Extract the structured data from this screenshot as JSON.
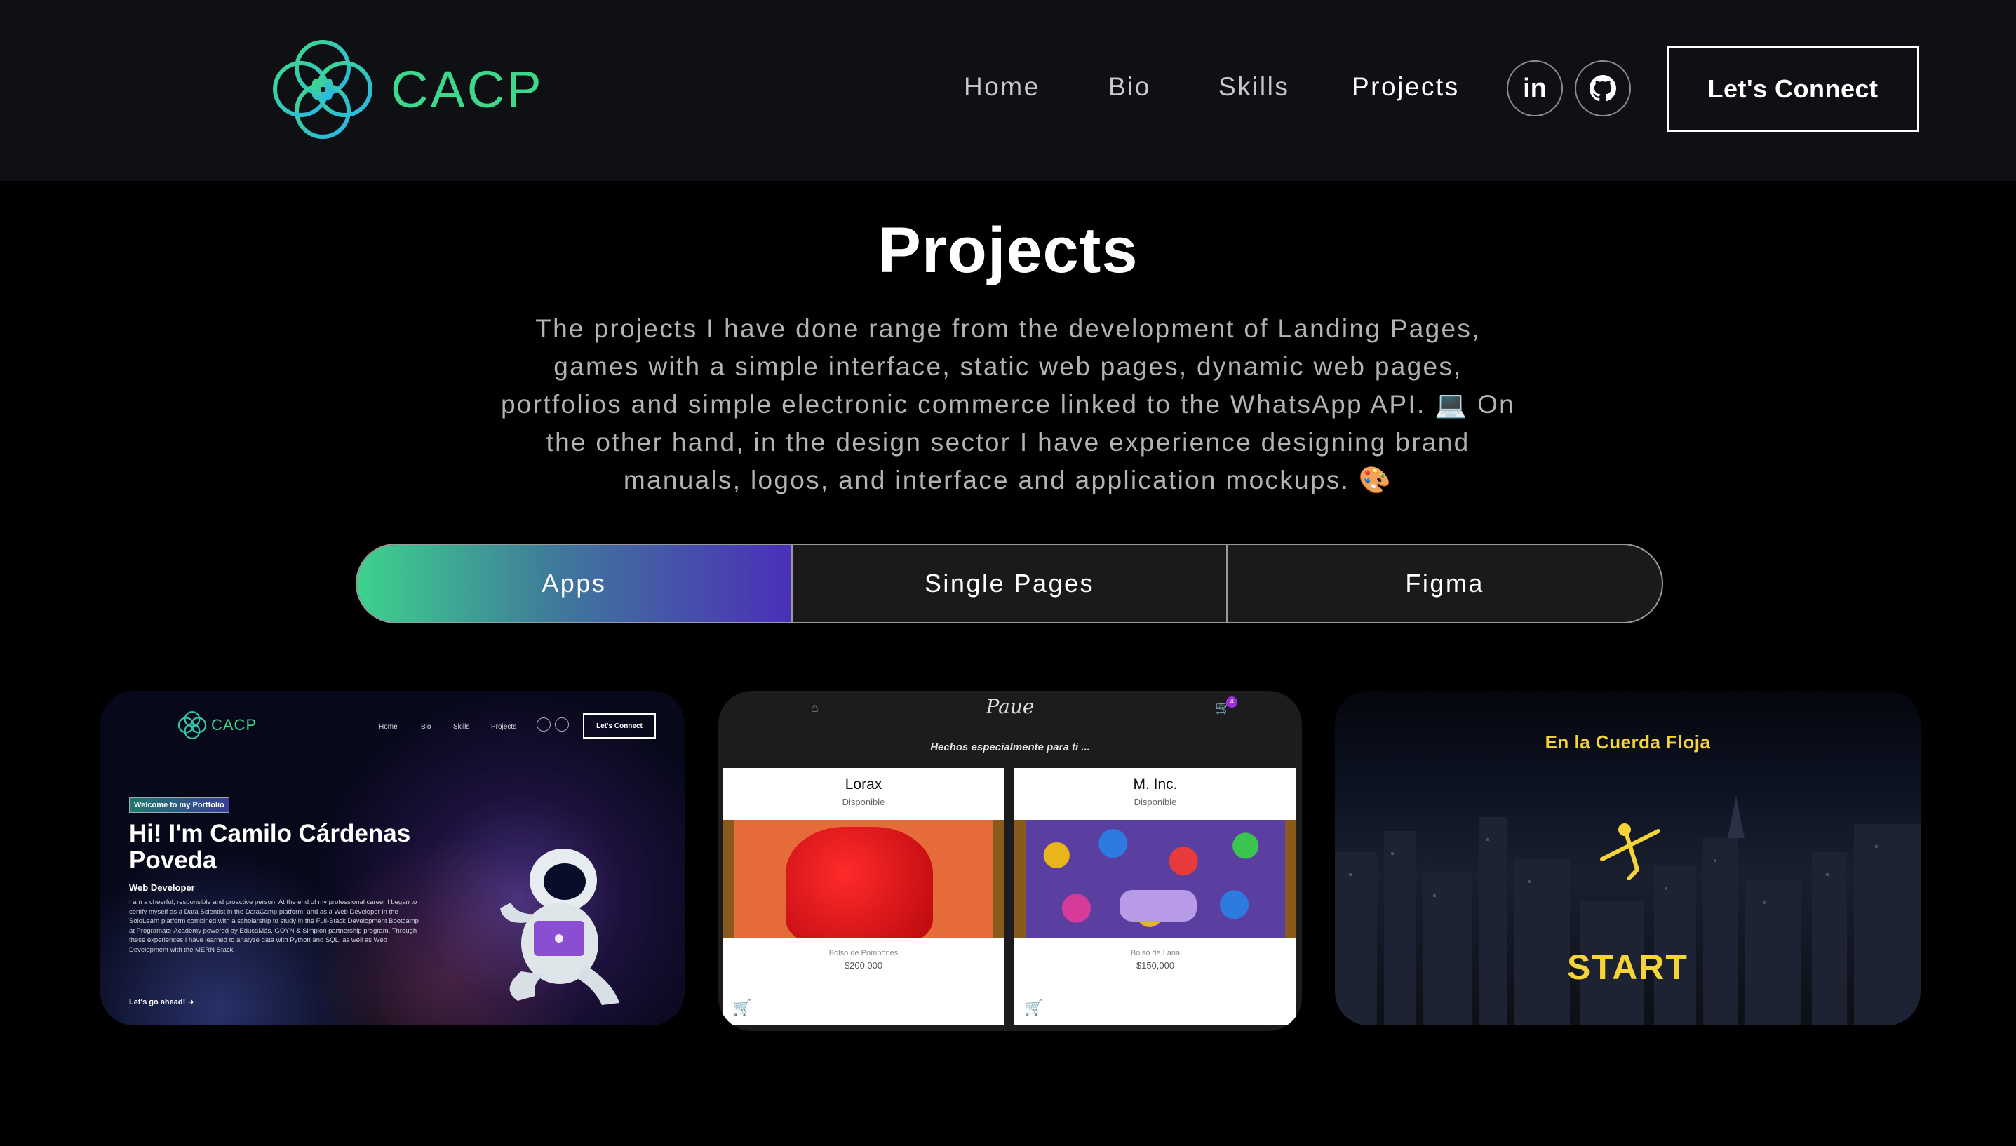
{
  "nav": {
    "logo_text": "CACP",
    "links": [
      {
        "label": "Home",
        "active": false
      },
      {
        "label": "Bio",
        "active": false
      },
      {
        "label": "Skills",
        "active": false
      },
      {
        "label": "Projects",
        "active": true
      }
    ],
    "social": [
      {
        "icon": "linkedin-icon",
        "label": "in"
      },
      {
        "icon": "github-icon"
      }
    ],
    "cta_label": "Let's Connect"
  },
  "section": {
    "title": "Projects",
    "description": "The projects I have done range from the development of Landing Pages, games with a simple interface, static web pages, dynamic web pages, portfolios and simple electronic commerce linked to the WhatsApp API. 💻 On the other hand, in the design sector I have experience designing brand manuals, logos, and interface and application mockups. 🎨"
  },
  "tabs": [
    {
      "label": "Apps",
      "active": true
    },
    {
      "label": "Single Pages",
      "active": false
    },
    {
      "label": "Figma",
      "active": false
    }
  ],
  "colors": {
    "accent_green": "#3ed88d",
    "accent_purple": "#4b2fb8",
    "nav_bg": "#0f1013",
    "game_yellow": "#f5d33a"
  },
  "cards": [
    {
      "kind": "portfolio",
      "logo_text": "CACP",
      "nav": [
        "Home",
        "Bio",
        "Skills",
        "Projects"
      ],
      "cta": "Let's Connect",
      "badge": "Welcome to my Portfolio",
      "hero": "Hi! I'm Camilo Cárdenas Poveda",
      "role": "Web Developer",
      "body": "I am a cheerful, responsible and proactive person. At the end of my professional career I began to certify myself as a Data Scientist in the DataCamp platform, and as a Web Developer in the SoloLearn platform combined with a scholarship to study in the Full-Stack Development Bootcamp at Programate-Academy powered by EducaMás, GOYN & Simplon partnership program. Through these experiences I have learned to analyze data with Python and SQL, as well as Web Development with the MERN Stack.",
      "link": "Let's go ahead!"
    },
    {
      "kind": "shop",
      "brand": "Paue",
      "cart_count": "4",
      "subtitle": "Hechos especialmente para ti ...",
      "products": [
        {
          "name": "Lorax",
          "status": "Disponible",
          "desc": "Bolso de Pompones",
          "price": "$200,000"
        },
        {
          "name": "M. Inc.",
          "status": "Disponible",
          "desc": "Bolso de Lana",
          "price": "$150,000"
        }
      ]
    },
    {
      "kind": "game",
      "title": "En la Cuerda Floja",
      "start": "START"
    }
  ]
}
